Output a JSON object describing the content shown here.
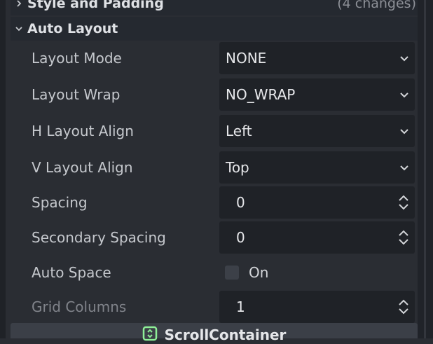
{
  "sections": {
    "style_padding": {
      "title": "Style and Padding",
      "changes": "(4 changes)"
    },
    "auto_layout": {
      "title": "Auto Layout"
    }
  },
  "properties": {
    "layout_mode": {
      "label": "Layout Mode",
      "value": "NONE"
    },
    "layout_wrap": {
      "label": "Layout Wrap",
      "value": "NO_WRAP"
    },
    "h_layout_align": {
      "label": "H Layout Align",
      "value": "Left"
    },
    "v_layout_align": {
      "label": "V Layout Align",
      "value": "Top"
    },
    "spacing": {
      "label": "Spacing",
      "value": "0"
    },
    "secondary_spacing": {
      "label": "Secondary Spacing",
      "value": "0"
    },
    "auto_space": {
      "label": "Auto Space",
      "checkbox_label": "On",
      "checked": false
    },
    "grid_columns": {
      "label": "Grid Columns",
      "value": "1"
    }
  },
  "bottom": {
    "title": "ScrollContainer",
    "icon": "scroll-container-node-icon",
    "icon_color": "#8eef97"
  },
  "colors": {
    "panel_bg": "#2a2d33",
    "field_bg": "#1f2227",
    "header_bg": "#252930",
    "bar_bg": "#3b3f47"
  }
}
